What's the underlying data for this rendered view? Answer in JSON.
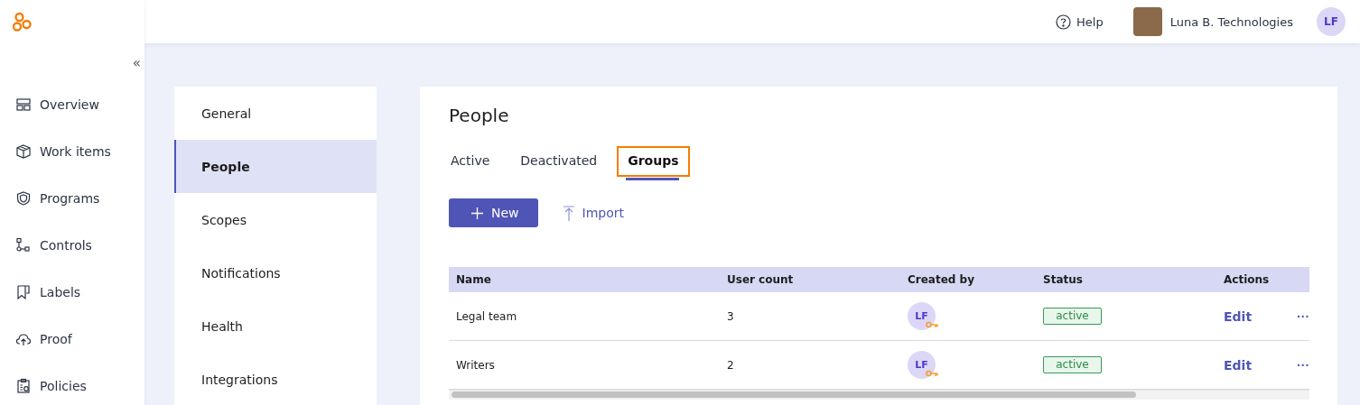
{
  "sidebar": {
    "collapse": "«",
    "items": [
      {
        "label": "Overview"
      },
      {
        "label": "Work items"
      },
      {
        "label": "Programs"
      },
      {
        "label": "Controls"
      },
      {
        "label": "Labels"
      },
      {
        "label": "Proof"
      },
      {
        "label": "Policies"
      }
    ]
  },
  "topbar": {
    "help": "Help",
    "organization": "Luna B. Technologies",
    "user_initials": "LF"
  },
  "settings_nav": [
    {
      "label": "General",
      "selected": false
    },
    {
      "label": "People",
      "selected": true
    },
    {
      "label": "Scopes",
      "selected": false
    },
    {
      "label": "Notifications",
      "selected": false
    },
    {
      "label": "Health",
      "selected": false
    },
    {
      "label": "Integrations",
      "selected": false
    }
  ],
  "panel": {
    "title": "People",
    "tabs": [
      {
        "label": "Active",
        "selected": false,
        "highlighted": false
      },
      {
        "label": "Deactivated",
        "selected": false,
        "highlighted": false
      },
      {
        "label": "Groups",
        "selected": true,
        "highlighted": true
      }
    ],
    "buttons": [
      {
        "label": "New",
        "kind": "primary"
      },
      {
        "label": "Import",
        "kind": "link"
      }
    ],
    "table": {
      "columns": [
        "Name",
        "User count",
        "Created by",
        "Status",
        "Actions"
      ],
      "rows": [
        {
          "name": "Legal team",
          "user_count": "3",
          "created_by": "LF",
          "status": "active",
          "action": "Edit",
          "more": "···"
        },
        {
          "name": "Writers",
          "user_count": "2",
          "created_by": "LF",
          "status": "active",
          "action": "Edit",
          "more": "···"
        }
      ]
    }
  }
}
